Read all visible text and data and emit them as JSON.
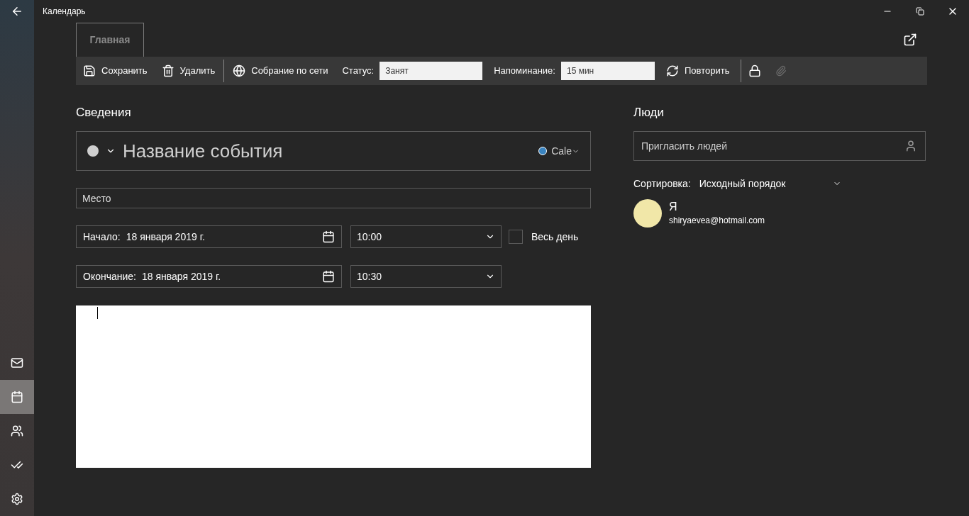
{
  "window": {
    "title": "Календарь"
  },
  "nav": [
    {
      "kind": "mail",
      "selected": false
    },
    {
      "kind": "calendar",
      "selected": true
    },
    {
      "kind": "people",
      "selected": false
    },
    {
      "kind": "todo",
      "selected": false
    },
    {
      "kind": "settings",
      "selected": false
    }
  ],
  "ribbon_tabs": [
    {
      "label": "Главная",
      "selected": true
    }
  ],
  "toolbar": {
    "save": "Сохранить",
    "delete": "Удалить",
    "online_meeting": "Собрание по сети",
    "status_label": "Статус:",
    "status_value": "Занят",
    "reminder_label": "Напоминание:",
    "reminder_value": "15 мин",
    "repeat": "Повторить",
    "attach_disabled": true
  },
  "details": {
    "heading": "Сведения",
    "title_placeholder": "Название события",
    "calendar_name": "Cale",
    "location_placeholder": "Место",
    "start": {
      "label": "Начало:",
      "date": "18 января 2019 г.",
      "time": "10:00"
    },
    "end": {
      "label": "Окончание:",
      "date": "18 января 2019 г.",
      "time": "10:30"
    },
    "all_day": {
      "label": "Весь день",
      "checked": false
    }
  },
  "people": {
    "heading": "Люди",
    "invite_placeholder": "Пригласить людей",
    "sort_label": "Сортировка:",
    "sort_value": "Исходный порядок",
    "attendees": [
      {
        "name": "Я",
        "email": "shiryaevea@hotmail.com"
      }
    ]
  }
}
